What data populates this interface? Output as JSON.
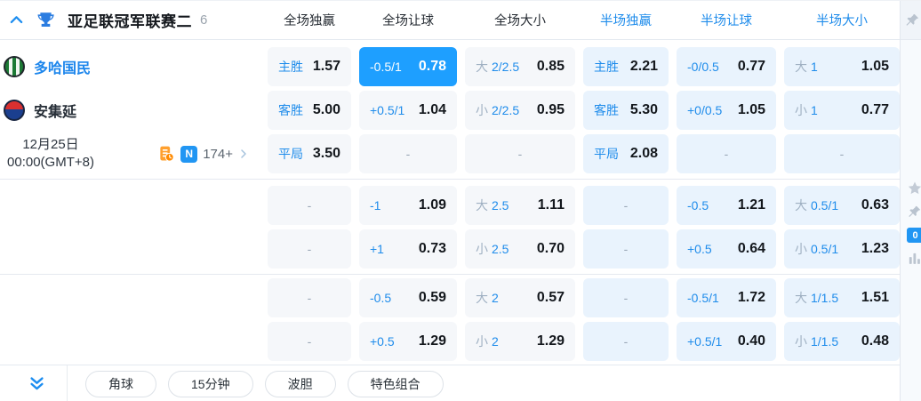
{
  "colors": {
    "accent_blue": "#1f8ceb",
    "selected_cell_bg": "#1e9fff",
    "badge_blue": "#2196f3"
  },
  "header": {
    "league": "亚足联冠军联赛二",
    "match_count": "6",
    "columns": [
      "全场独赢",
      "全场让球",
      "全场大小",
      "半场独赢",
      "半场让球",
      "半场大小"
    ]
  },
  "match": {
    "home_team": "多哈国民",
    "away_team": "安集延",
    "date": "12月25日",
    "time": "00:00(GMT+8)",
    "news_badge": "N",
    "extra_markets": "174+"
  },
  "odds": {
    "groups": [
      {
        "rows": [
          {
            "cells": [
              {
                "label": "主胜",
                "value": "1.57"
              },
              {
                "label": "-0.5/1",
                "value": "0.78",
                "selected": true
              },
              {
                "prefix": "大",
                "label": "2/2.5",
                "value": "0.85"
              },
              {
                "label": "主胜",
                "value": "2.21"
              },
              {
                "label": "-0/0.5",
                "value": "0.77"
              },
              {
                "prefix": "大",
                "label": "1",
                "value": "1.05"
              }
            ]
          },
          {
            "cells": [
              {
                "label": "客胜",
                "value": "5.00"
              },
              {
                "label": "+0.5/1",
                "value": "1.04"
              },
              {
                "prefix": "小",
                "label": "2/2.5",
                "value": "0.95"
              },
              {
                "label": "客胜",
                "value": "5.30"
              },
              {
                "label": "+0/0.5",
                "value": "1.05"
              },
              {
                "prefix": "小",
                "label": "1",
                "value": "0.77"
              }
            ]
          },
          {
            "cells": [
              {
                "label": "平局",
                "value": "3.50"
              },
              {
                "dash": "-"
              },
              {
                "dash": "-"
              },
              {
                "label": "平局",
                "value": "2.08"
              },
              {
                "dash": "-"
              },
              {
                "dash": "-"
              }
            ]
          }
        ]
      },
      {
        "rows": [
          {
            "cells": [
              {
                "dash": "-"
              },
              {
                "label": "-1",
                "value": "1.09"
              },
              {
                "prefix": "大",
                "label": "2.5",
                "value": "1.11"
              },
              {
                "dash": "-"
              },
              {
                "label": "-0.5",
                "value": "1.21"
              },
              {
                "prefix": "大",
                "label": "0.5/1",
                "value": "0.63"
              }
            ]
          },
          {
            "cells": [
              {
                "dash": "-"
              },
              {
                "label": "+1",
                "value": "0.73"
              },
              {
                "prefix": "小",
                "label": "2.5",
                "value": "0.70"
              },
              {
                "dash": "-"
              },
              {
                "label": "+0.5",
                "value": "0.64"
              },
              {
                "prefix": "小",
                "label": "0.5/1",
                "value": "1.23"
              }
            ]
          }
        ]
      },
      {
        "rows": [
          {
            "cells": [
              {
                "dash": "-"
              },
              {
                "label": "-0.5",
                "value": "0.59"
              },
              {
                "prefix": "大",
                "label": "2",
                "value": "0.57"
              },
              {
                "dash": "-"
              },
              {
                "label": "-0.5/1",
                "value": "1.72"
              },
              {
                "prefix": "大",
                "label": "1/1.5",
                "value": "1.51"
              }
            ]
          },
          {
            "cells": [
              {
                "dash": "-"
              },
              {
                "label": "+0.5",
                "value": "1.29"
              },
              {
                "prefix": "小",
                "label": "2",
                "value": "1.29"
              },
              {
                "dash": "-"
              },
              {
                "label": "+0.5/1",
                "value": "0.40"
              },
              {
                "prefix": "小",
                "label": "1/1.5",
                "value": "0.48"
              }
            ]
          }
        ]
      }
    ]
  },
  "footer": {
    "buttons": [
      "角球",
      "15分钟",
      "波胆",
      "特色组合"
    ]
  },
  "right_rail": {
    "badge_count": "0"
  }
}
